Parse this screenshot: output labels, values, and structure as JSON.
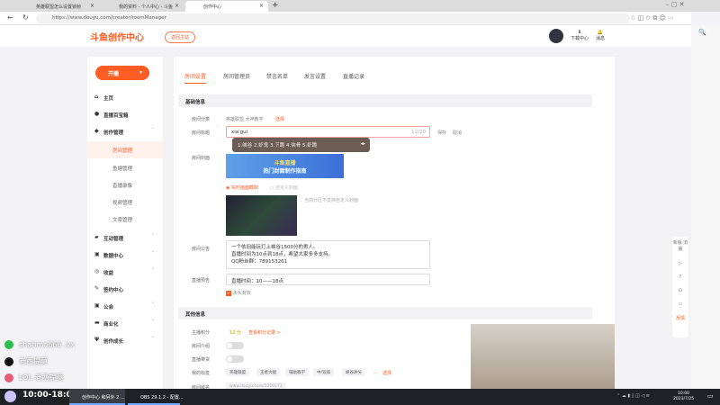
{
  "browser": {
    "tabs": [
      {
        "label": "英雄联盟怎么设置锁帧"
      },
      {
        "label": "我的资料 - 个人中心 - 斗鱼"
      },
      {
        "label": "创作中心"
      }
    ],
    "url": "https://www.douyu.com/creator/roomManager"
  },
  "header": {
    "logo": "斗鱼创作中心",
    "badge": "返回主站",
    "download": "下载中心",
    "messages": "消息"
  },
  "sidebar": {
    "live_button": "开播",
    "items": [
      {
        "label": "主页"
      },
      {
        "label": "直播百宝箱"
      },
      {
        "label": "创作管理"
      },
      {
        "label": "房间管理"
      },
      {
        "label": "鱼塘管理"
      },
      {
        "label": "直播录像"
      },
      {
        "label": "视频管理"
      },
      {
        "label": "文章管理"
      },
      {
        "label": "互动管理"
      },
      {
        "label": "数据中心"
      },
      {
        "label": "收益"
      },
      {
        "label": "签约中心"
      },
      {
        "label": "公会"
      },
      {
        "label": "商业化"
      },
      {
        "label": "创作成长"
      }
    ]
  },
  "tabs": [
    "房间设置",
    "房间管理员",
    "禁言名单",
    "发言设置",
    "直播记录"
  ],
  "basic": {
    "title": "基础信息",
    "category_label": "房间分类",
    "category_value": "英雄联盟 大神教学",
    "category_action": "选择",
    "title_label": "房间标题",
    "title_value": "xia'gui",
    "title_count": "12/20",
    "save": "保存",
    "cancel": "取消",
    "ime_candidates": "1.峡谷 2.虾鬼 3.下跪 4.侠骨 5.虾跪",
    "cover_label": "房间封面",
    "banner_line1": "斗鱼直播",
    "banner_line2": "热门封面制作指南",
    "radio_live": "实时画面截取",
    "radio_custom": "自定义封面",
    "cover_hint": "当前分区不支持自定义封面",
    "notice_label": "房间公告",
    "notice_lines": [
      "一个依旧能玩打上峡谷1500分的男人。",
      "直播时间为10点到18点，希望大家多多支持。",
      "QQ粉丝群：789153261"
    ],
    "forecast_label": "直播预告",
    "forecast_value": "直播时间：10——18点",
    "permanent": "永久有效"
  },
  "other": {
    "title": "其他信息",
    "score_label": "主播积分",
    "score_value": "12 分",
    "score_link": "查看积分记录 >",
    "intro_label": "房间介绍",
    "bag_label": "直播带货",
    "tags_label": "我的标签",
    "tags": [
      "英雄联盟",
      "王者大腿",
      "辅助教学",
      "中/双排",
      "峡谷冲分"
    ],
    "tags_more": "...",
    "tags_action": "选择",
    "domain_label": "房间域名",
    "domain_value": "www.douyu.com/5220173"
  },
  "overlay": {
    "wechat": "shatimo666 .vx",
    "douyin": "老西提莫",
    "lol": "LOL 老西提莫",
    "schedule": "10:00-18:00"
  },
  "taskbar": {
    "app1": "创作中心 和另外 2 ...",
    "app2": "OBS 29.1.2 - 配置...",
    "time": "10:00",
    "date": "2023/7/25"
  },
  "float": {
    "top": "新版 旧版",
    "bottom": "反馈"
  }
}
